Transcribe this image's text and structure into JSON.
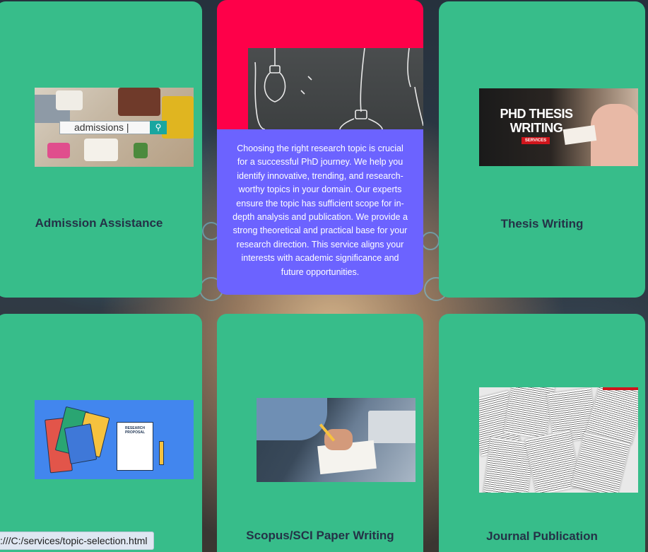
{
  "cards": {
    "admission": {
      "title": "Admission Assistance",
      "search_text": "admissions",
      "cursor": "|",
      "icon": "search-icon"
    },
    "topic_selection": {
      "description": "Choosing the right research topic is crucial for a successful PhD journey. We help you identify innovative, trending, and research-worthy topics in your domain. Our experts ensure the topic has sufficient scope for in-depth analysis and publication. We provide a strong theoretical and practical base for your research direction. This service aligns your interests with academic significance and future opportunities."
    },
    "thesis": {
      "title": "Thesis Writing",
      "image_text": "PHD THESIS WRITING",
      "image_badge": "SERVICES"
    },
    "proposal": {
      "title": "",
      "image_text": "RESEARCH PROPOSAL"
    },
    "scopus": {
      "title": "Scopus/SCI Paper Writing"
    },
    "journal": {
      "title": "Journal Publication"
    }
  },
  "status_bar": {
    "url": ":///C:/services/topic-selection.html"
  },
  "colors": {
    "card": "#37bd8a",
    "hover_top": "#fe0049",
    "hover_desc": "#6c63ff",
    "title_text": "#243247"
  }
}
